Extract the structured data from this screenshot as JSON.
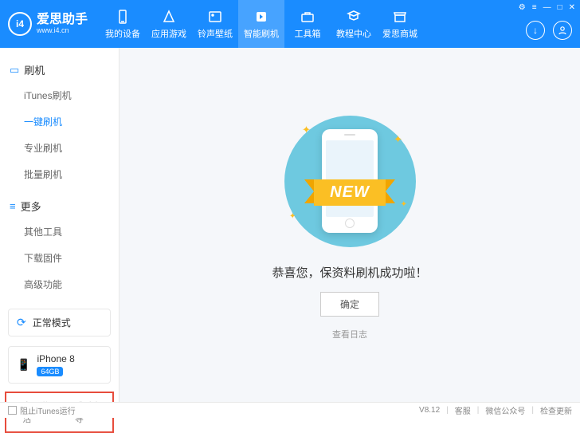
{
  "header": {
    "logo_text": "i4",
    "brand": "爱思助手",
    "url": "www.i4.cn",
    "nav": [
      {
        "label": "我的设备"
      },
      {
        "label": "应用游戏"
      },
      {
        "label": "铃声壁纸"
      },
      {
        "label": "智能刷机"
      },
      {
        "label": "工具箱"
      },
      {
        "label": "教程中心"
      },
      {
        "label": "爱思商城"
      }
    ]
  },
  "sidebar": {
    "section1": {
      "title": "刷机",
      "items": [
        "iTunes刷机",
        "一键刷机",
        "专业刷机",
        "批量刷机"
      ]
    },
    "section2": {
      "title": "更多",
      "items": [
        "其他工具",
        "下载固件",
        "高级功能"
      ]
    },
    "mode": "正常模式",
    "device": {
      "name": "iPhone 8",
      "storage": "64GB"
    },
    "cb1": "自动激活",
    "cb2": "跳过向导"
  },
  "main": {
    "ribbon": "NEW",
    "success": "恭喜您，保资料刷机成功啦！",
    "ok": "确定",
    "log": "查看日志"
  },
  "footer": {
    "block_itunes": "阻止iTunes运行",
    "version": "V8.12",
    "links": [
      "客服",
      "微信公众号",
      "检查更新"
    ]
  }
}
